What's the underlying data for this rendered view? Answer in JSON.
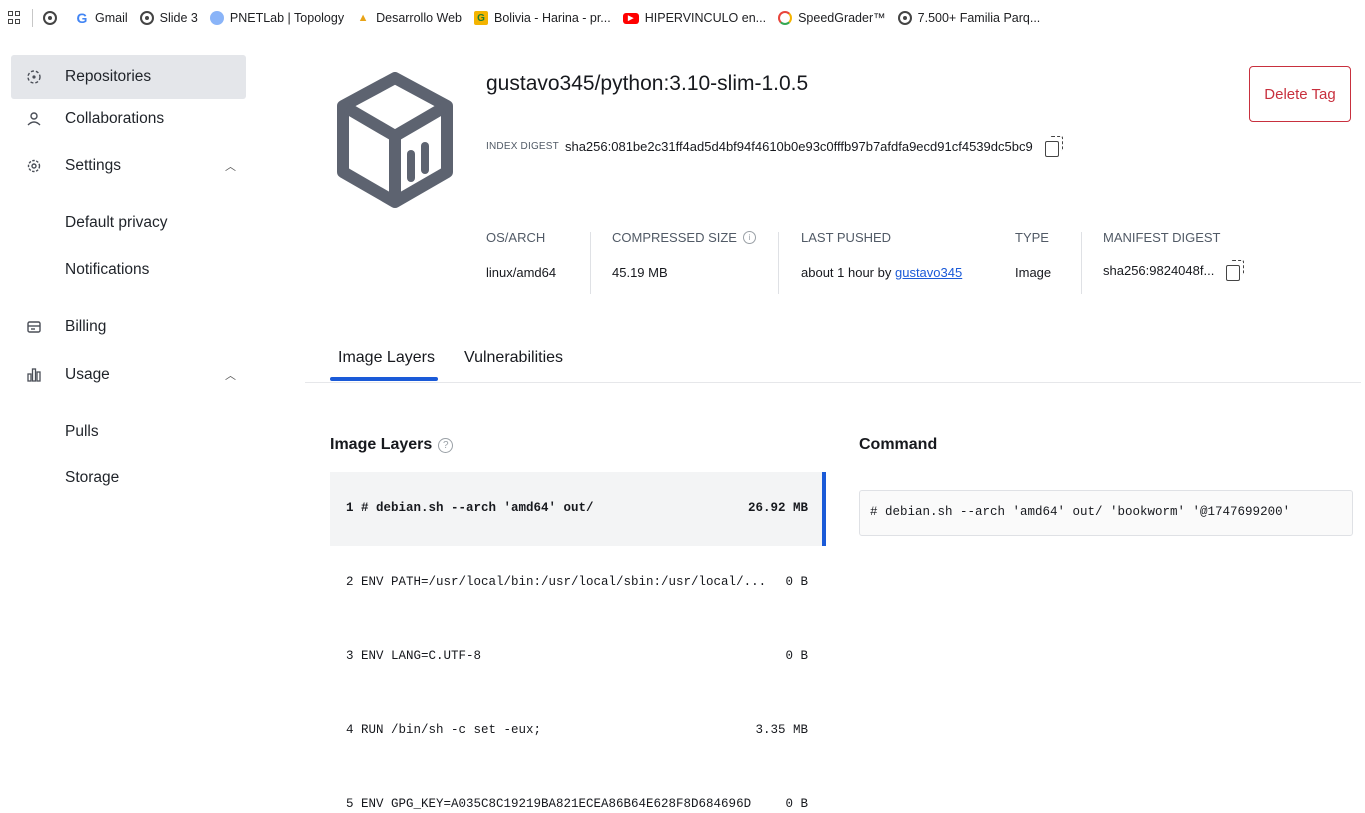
{
  "bookmarks": [
    {
      "label": "Gmail",
      "icon": "gmail-icon"
    },
    {
      "label": "Slide 3",
      "icon": "globe-icon"
    },
    {
      "label": "PNETLab | Topology",
      "icon": "pnetlab-icon"
    },
    {
      "label": "Desarrollo Web",
      "icon": "pma-icon"
    },
    {
      "label": "Bolivia - Harina - pr...",
      "icon": "google-sheets-icon"
    },
    {
      "label": "HIPERVINCULO en...",
      "icon": "youtube-icon"
    },
    {
      "label": "SpeedGrader™",
      "icon": "speedgrader-icon"
    },
    {
      "label": "7.500+ Familia Parq...",
      "icon": "globe-icon"
    }
  ],
  "sidebar": {
    "items": [
      {
        "label": "Repositories",
        "icon": "repositories-icon"
      },
      {
        "label": "Collaborations",
        "icon": "collaborations-icon"
      },
      {
        "label": "Settings",
        "icon": "gear-icon"
      },
      {
        "label": "Default privacy"
      },
      {
        "label": "Notifications"
      },
      {
        "label": "Billing",
        "icon": "billing-icon"
      },
      {
        "label": "Usage",
        "icon": "usage-icon"
      },
      {
        "label": "Pulls"
      },
      {
        "label": "Storage"
      }
    ]
  },
  "header": {
    "title": "gustavo345/python:3.10-slim-1.0.5",
    "index_digest_label": "INDEX DIGEST",
    "index_digest": "sha256:081be2c31ff4ad5d4bf94f4610b0e93c0fffb97b7afdfa9ecd91cf4539dc5bc9",
    "delete_label": "Delete Tag"
  },
  "meta": {
    "os_arch_label": "OS/ARCH",
    "os_arch": "linux/amd64",
    "compressed_size_label": "COMPRESSED SIZE",
    "compressed_size": "45.19 MB",
    "last_pushed_label": "LAST PUSHED",
    "last_pushed_prefix": "about 1 hour by",
    "last_pushed_user": "gustavo345",
    "type_label": "TYPE",
    "type": "Image",
    "manifest_digest_label": "MANIFEST DIGEST",
    "manifest_digest": "sha256:9824048f..."
  },
  "tabs": [
    {
      "label": "Image Layers"
    },
    {
      "label": "Vulnerabilities"
    }
  ],
  "layers": {
    "title": "Image Layers",
    "rows": [
      {
        "command": "1 # debian.sh --arch 'amd64' out/",
        "size": "26.92 MB"
      },
      {
        "command": "2 ENV PATH=/usr/local/bin:/usr/local/sbin:/usr/local/...",
        "size": "0 B"
      },
      {
        "command": "3 ENV LANG=C.UTF-8",
        "size": "0 B"
      },
      {
        "command": "4 RUN /bin/sh -c set -eux;",
        "size": "3.35 MB"
      },
      {
        "command": "5 ENV GPG_KEY=A035C8C19219BA821ECEA86B64E628F8D684696D",
        "size": "0 B"
      }
    ]
  },
  "command": {
    "title": "Command",
    "text": "# debian.sh --arch 'amd64' out/ 'bookworm' '@1747699200'"
  },
  "colors": {
    "accent": "#1a5ad8",
    "danger": "#c8303e",
    "sidebar_active": "#e4e6ea"
  }
}
